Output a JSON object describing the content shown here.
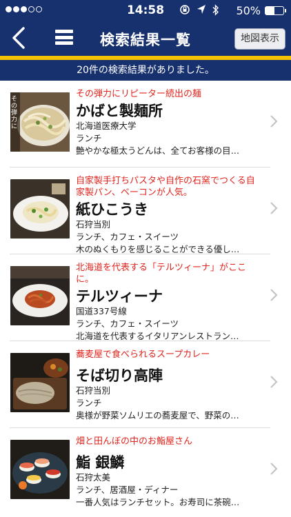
{
  "status_bar": {
    "time": "14:58",
    "battery": "50%",
    "battery_level": 0.5,
    "signal_bars_filled": 3,
    "signal_bars_total": 5
  },
  "navbar": {
    "title": "検索結果一覧",
    "map_button": "地図表示"
  },
  "summary": "20件の検索結果がありました。",
  "colors": {
    "navy": "#17306e",
    "gold": "#f2c200",
    "catch_red": "#e0241d"
  },
  "results": [
    {
      "catch": "その弾力にリピーター続出の麺",
      "name": "かばと製麺所",
      "area": "北海道医療大学",
      "category": "ランチ",
      "description": "艶やかな極太うどんは、全てお客様の目…",
      "thumb_text": "その弾力に"
    },
    {
      "catch": "自家製手打ちパスタや自作の石窯でつくる自家製パン、ベーコンが人気。",
      "name": "紙ひこうき",
      "area": "石狩当別",
      "category": "ランチ、カフェ・スイーツ",
      "description": "木のぬくもりを感じることができる優し…"
    },
    {
      "catch": "北海道を代表する「テルツィーナ」がここに。",
      "name": "テルツィーナ",
      "area": "国道337号線",
      "category": "ランチ、カフェ・スイーツ",
      "description": "北海道を代表するイタリアンレストラン…"
    },
    {
      "catch": "蕎麦屋で食べられるスープカレー",
      "name": "そば切り高陣",
      "area": "石狩当別",
      "category": "ランチ",
      "description": "奥様が野菜ソムリエの蕎麦屋で、野菜の…"
    },
    {
      "catch": "畑と田んぼの中のお鮨屋さん",
      "name": "鮨 銀鱗",
      "area": "石狩太美",
      "category": "ランチ、居酒屋・ディナー",
      "description": "一番人気はランチセット。お寿司に茶碗…"
    }
  ]
}
